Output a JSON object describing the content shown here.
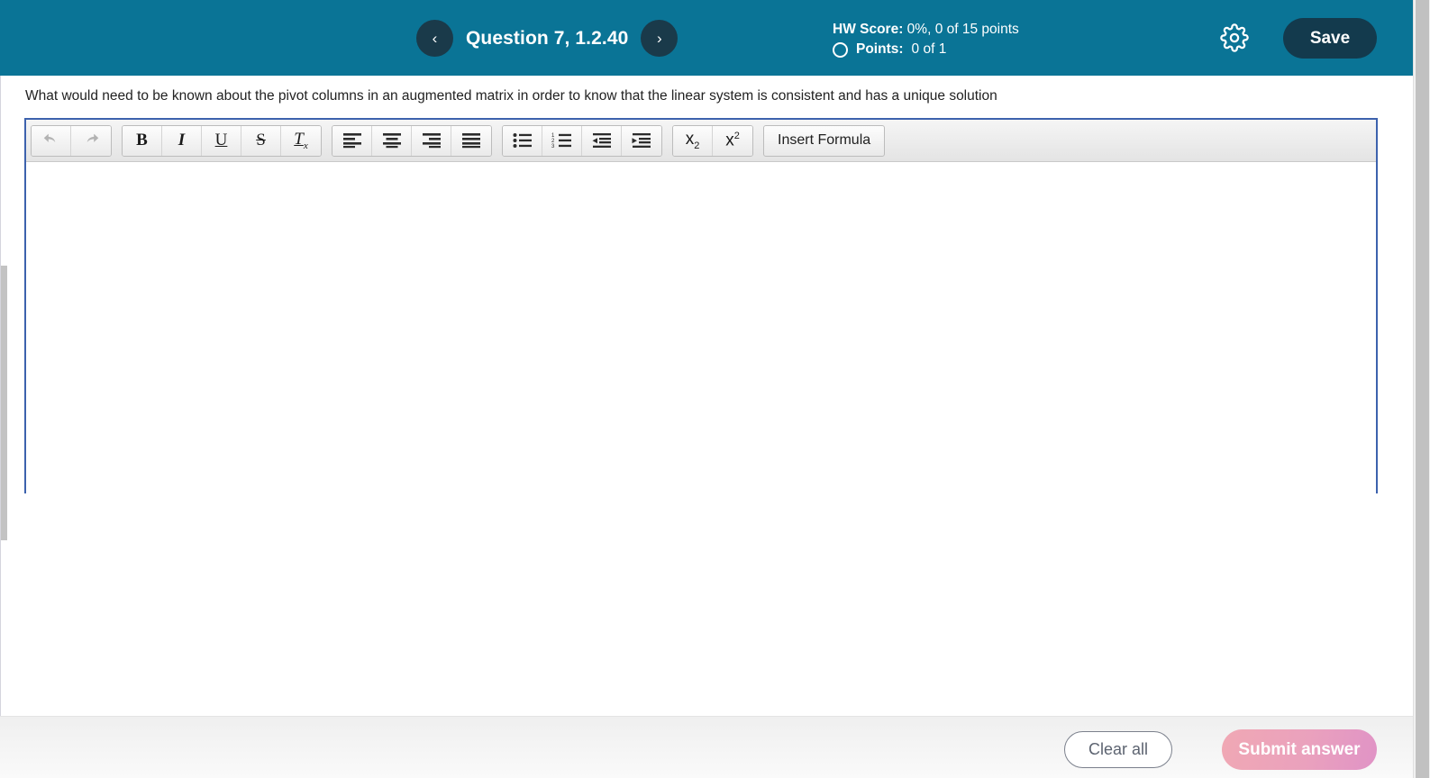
{
  "header": {
    "prev_label": "‹",
    "next_label": "›",
    "question_title": "Question 7, 1.2.40",
    "hw_score_label": "HW Score:",
    "hw_score_value": " 0%, 0 of 15 points",
    "points_label": "Points:",
    "points_value": " 0 of 1",
    "gear_icon": "gear-icon",
    "status_icon": "circle-outline-icon",
    "save_label": "Save",
    "bg_color": "#0a7496",
    "save_bg_color": "#133a4d"
  },
  "question": {
    "text": "What would need to be known about the pivot columns in an augmented matrix in order to know that the linear system is consistent and has a unique solution"
  },
  "editor": {
    "border_color": "#3d62ad",
    "content": "",
    "toolbar": {
      "groups": [
        {
          "name": "history",
          "buttons": [
            {
              "name": "undo-button",
              "icon": "undo-icon",
              "label": "↶",
              "disabled": true
            },
            {
              "name": "redo-button",
              "icon": "redo-icon",
              "label": "↷",
              "disabled": true
            }
          ]
        },
        {
          "name": "text-style",
          "buttons": [
            {
              "name": "bold-button",
              "icon": "bold-icon",
              "label": "B",
              "disabled": false
            },
            {
              "name": "italic-button",
              "icon": "italic-icon",
              "label": "I",
              "disabled": false
            },
            {
              "name": "underline-button",
              "icon": "underline-icon",
              "label": "U",
              "disabled": false
            },
            {
              "name": "strikethrough-button",
              "icon": "strikethrough-icon",
              "label": "S",
              "disabled": false
            },
            {
              "name": "remove-format-button",
              "icon": "remove-format-icon",
              "label": "Tx",
              "disabled": false
            }
          ]
        },
        {
          "name": "alignment",
          "buttons": [
            {
              "name": "align-left-button",
              "icon": "align-left-icon",
              "label": "",
              "disabled": false
            },
            {
              "name": "align-center-button",
              "icon": "align-center-icon",
              "label": "",
              "disabled": false
            },
            {
              "name": "align-right-button",
              "icon": "align-right-icon",
              "label": "",
              "disabled": false
            },
            {
              "name": "align-justify-button",
              "icon": "align-justify-icon",
              "label": "",
              "disabled": false
            }
          ]
        },
        {
          "name": "lists",
          "buttons": [
            {
              "name": "bulleted-list-button",
              "icon": "bulleted-list-icon",
              "label": "",
              "disabled": false
            },
            {
              "name": "numbered-list-button",
              "icon": "numbered-list-icon",
              "label": "",
              "disabled": false
            },
            {
              "name": "outdent-button",
              "icon": "outdent-icon",
              "label": "",
              "disabled": false
            },
            {
              "name": "indent-button",
              "icon": "indent-icon",
              "label": "",
              "disabled": false
            }
          ]
        },
        {
          "name": "script",
          "buttons": [
            {
              "name": "subscript-button",
              "icon": "subscript-icon",
              "label": "x",
              "disabled": false
            },
            {
              "name": "superscript-button",
              "icon": "superscript-icon",
              "label": "x",
              "disabled": false
            }
          ]
        }
      ],
      "insert_formula_label": "Insert Formula"
    }
  },
  "footer": {
    "clear_label": "Clear all",
    "submit_label": "Submit answer",
    "submit_color": "#eaa1bd"
  }
}
